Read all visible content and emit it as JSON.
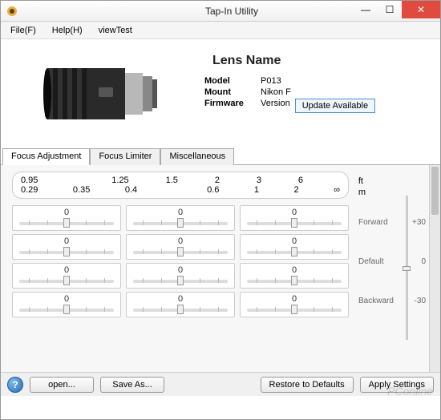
{
  "window": {
    "title": "Tap-In Utility"
  },
  "menu": {
    "file": "File(F)",
    "help": "Help(H)",
    "viewtest": "viewTest"
  },
  "lens": {
    "title": "Lens Name",
    "model_label": "Model",
    "model_value": "P013",
    "mount_label": "Mount",
    "mount_value": "Nikon F",
    "fw_label": "Firmware",
    "fw_value": "Version",
    "update_btn": "Update Available"
  },
  "tabs": {
    "focus_adj": "Focus Adjustment",
    "focus_lim": "Focus Limiter",
    "misc": "Miscellaneous"
  },
  "scale": {
    "ft": [
      "0.95",
      "",
      "1.25",
      "1.5",
      "2",
      "3",
      "6",
      ""
    ],
    "m": [
      "0.29",
      "0.35",
      "0.4",
      "",
      "0.6",
      "1",
      "2",
      "∞"
    ],
    "unit_ft": "ft",
    "unit_m": "m"
  },
  "sliders": {
    "rows": [
      [
        "0",
        "0",
        "0"
      ],
      [
        "0",
        "0",
        "0"
      ],
      [
        "0",
        "0",
        "0"
      ],
      [
        "0",
        "0",
        "0"
      ]
    ]
  },
  "side": {
    "forward": "Forward",
    "forward_val": "+30",
    "default": "Default",
    "default_val": "0",
    "backward": "Backward",
    "backward_val": "-30"
  },
  "buttons": {
    "open": "open...",
    "saveas": "Save As...",
    "restore": "Restore to Defaults",
    "apply": "Apply Settings"
  },
  "watermark": "PConline"
}
